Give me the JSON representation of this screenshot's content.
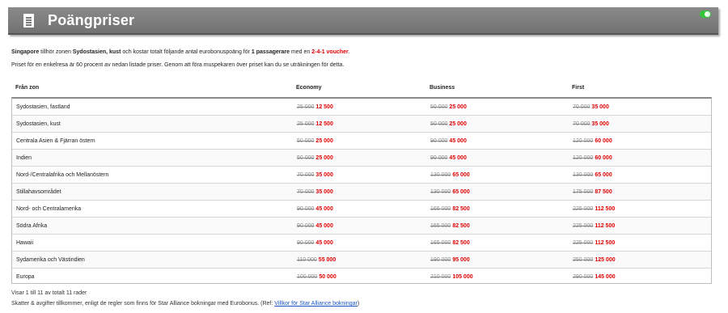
{
  "header": {
    "title": "Poängpriser"
  },
  "info": {
    "line1": {
      "p1": "Singapore",
      "p2": " tillhör zonen ",
      "p3": "Sydostasien, kust",
      "p4": " och kostar totalt följande antal eurobonuspoäng för ",
      "p5": "1 passagerare",
      "p6": " med en ",
      "p7": "2-4-1 voucher",
      "p8": "."
    },
    "line2": "Priset för en enkelresa är 60 procent av nedan listade priser. Genom att föra muspekaren över priset kan du se uträkningen för detta."
  },
  "table": {
    "headers": [
      "Från zon",
      "Economy",
      "Business",
      "First"
    ],
    "rows": [
      {
        "zone": "Sydostasien, fastland",
        "eco_old": "25 000",
        "eco_new": "12 500",
        "bus_old": "50 000",
        "bus_new": "25 000",
        "first_old": "70 000",
        "first_new": "35 000"
      },
      {
        "zone": "Sydostasien, kust",
        "eco_old": "25 000",
        "eco_new": "12 500",
        "bus_old": "50 000",
        "bus_new": "25 000",
        "first_old": "70 000",
        "first_new": "35 000"
      },
      {
        "zone": "Centrala Asien & Fjärran östern",
        "eco_old": "50 000",
        "eco_new": "25 000",
        "bus_old": "90 000",
        "bus_new": "45 000",
        "first_old": "120 000",
        "first_new": "60 000"
      },
      {
        "zone": "Indien",
        "eco_old": "50 000",
        "eco_new": "25 000",
        "bus_old": "90 000",
        "bus_new": "45 000",
        "first_old": "120 000",
        "first_new": "60 000"
      },
      {
        "zone": "Nord-/Centralafrika och Mellanöstern",
        "eco_old": "70 000",
        "eco_new": "35 000",
        "bus_old": "130 000",
        "bus_new": "65 000",
        "first_old": "130 000",
        "first_new": "65 000"
      },
      {
        "zone": "Stillahavsområdet",
        "eco_old": "70 000",
        "eco_new": "35 000",
        "bus_old": "130 000",
        "bus_new": "65 000",
        "first_old": "175 000",
        "first_new": "87 500"
      },
      {
        "zone": "Nord- och Centralamerika",
        "eco_old": "90 000",
        "eco_new": "45 000",
        "bus_old": "165 000",
        "bus_new": "82 500",
        "first_old": "225 000",
        "first_new": "112 500"
      },
      {
        "zone": "Södra Afrika",
        "eco_old": "90 000",
        "eco_new": "45 000",
        "bus_old": "165 000",
        "bus_new": "82 500",
        "first_old": "225 000",
        "first_new": "112 500"
      },
      {
        "zone": "Hawaii",
        "eco_old": "90 000",
        "eco_new": "45 000",
        "bus_old": "165 000",
        "bus_new": "82 500",
        "first_old": "225 000",
        "first_new": "112 500"
      },
      {
        "zone": "Sydamerika och Västindien",
        "eco_old": "110 000",
        "eco_new": "55 000",
        "bus_old": "190 000",
        "bus_new": "95 000",
        "first_old": "250 000",
        "first_new": "125 000"
      },
      {
        "zone": "Europa",
        "eco_old": "100 000",
        "eco_new": "50 000",
        "bus_old": "210 000",
        "bus_new": "105 000",
        "first_old": "290 000",
        "first_new": "145 000"
      }
    ]
  },
  "footer": {
    "rows_info": "Visar 1 till 11 av totalt 11 rader",
    "note": "Skatter & avgifter tillkommer, enligt de regler som finns för Star Alliance bokningar med Eurobonus. (Ref: ",
    "link": "Villkor för Star Alliance bokningar",
    "note_end": ")"
  },
  "icons": {
    "header_icon": "document-icon",
    "toggle": "toggle-icon"
  },
  "colors": {
    "header_bg": "#7c7c7c",
    "price_red": "#e00000",
    "link_blue": "#1a55c8",
    "toggle_green": "#36c53a"
  }
}
